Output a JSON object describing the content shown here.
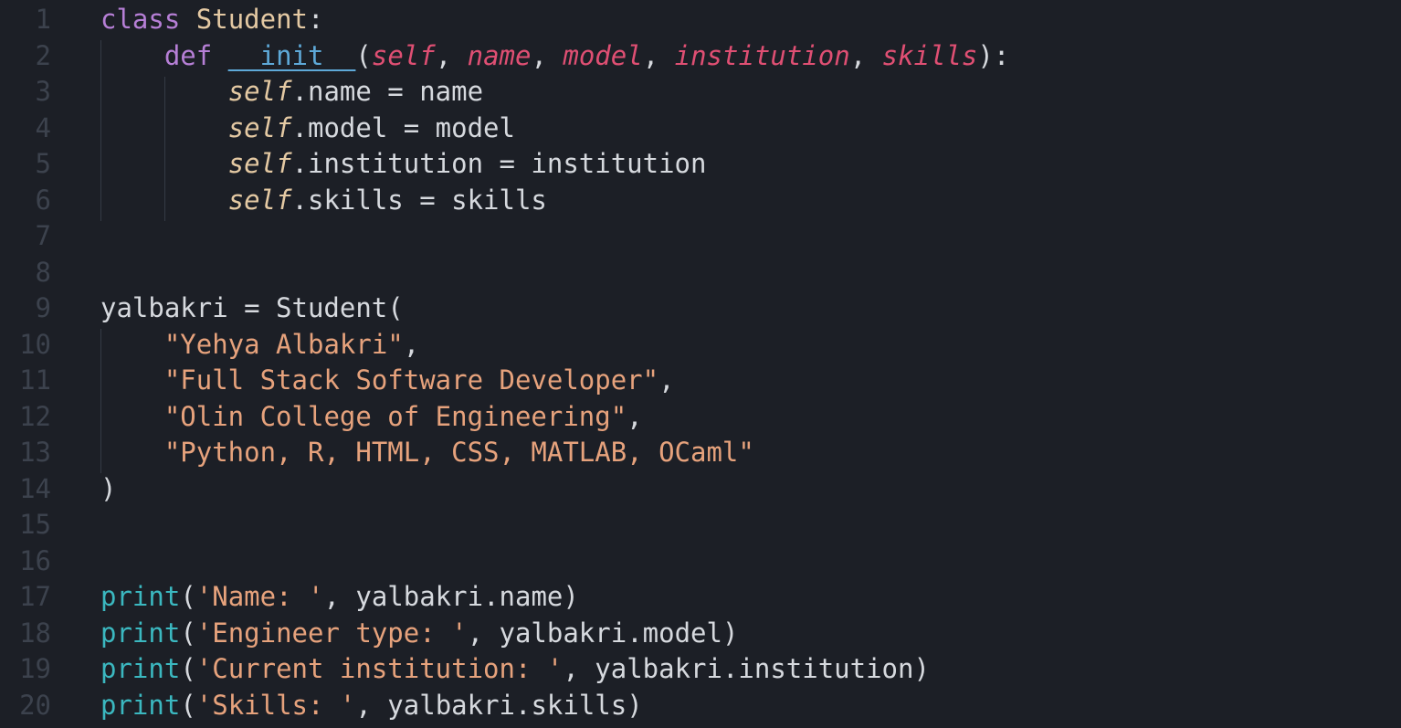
{
  "editor": {
    "lines": [
      {
        "n": "1",
        "tokens": [
          [
            "kw",
            "class"
          ],
          [
            "plain",
            " "
          ],
          [
            "cls",
            "Student"
          ],
          [
            "plain",
            ":"
          ]
        ]
      },
      {
        "n": "2",
        "tokens": [
          [
            "plain",
            "    "
          ],
          [
            "kw",
            "def"
          ],
          [
            "plain",
            " "
          ],
          [
            "fn-def",
            "__init__"
          ],
          [
            "plain",
            "("
          ],
          [
            "param",
            "self"
          ],
          [
            "plain",
            ", "
          ],
          [
            "param",
            "name"
          ],
          [
            "plain",
            ", "
          ],
          [
            "param",
            "model"
          ],
          [
            "plain",
            ", "
          ],
          [
            "param",
            "institution"
          ],
          [
            "plain",
            ", "
          ],
          [
            "param",
            "skills"
          ],
          [
            "plain",
            "):"
          ]
        ]
      },
      {
        "n": "3",
        "tokens": [
          [
            "plain",
            "        "
          ],
          [
            "self",
            "self"
          ],
          [
            "plain",
            ".name = name"
          ]
        ]
      },
      {
        "n": "4",
        "tokens": [
          [
            "plain",
            "        "
          ],
          [
            "self",
            "self"
          ],
          [
            "plain",
            ".model = model"
          ]
        ]
      },
      {
        "n": "5",
        "tokens": [
          [
            "plain",
            "        "
          ],
          [
            "self",
            "self"
          ],
          [
            "plain",
            ".institution = institution"
          ]
        ]
      },
      {
        "n": "6",
        "tokens": [
          [
            "plain",
            "        "
          ],
          [
            "self",
            "self"
          ],
          [
            "plain",
            ".skills = skills"
          ]
        ]
      },
      {
        "n": "7",
        "tokens": []
      },
      {
        "n": "8",
        "tokens": []
      },
      {
        "n": "9",
        "tokens": [
          [
            "plain",
            "yalbakri = Student("
          ]
        ]
      },
      {
        "n": "10",
        "tokens": [
          [
            "plain",
            "    "
          ],
          [
            "str",
            "\"Yehya Albakri\""
          ],
          [
            "plain",
            ","
          ]
        ]
      },
      {
        "n": "11",
        "tokens": [
          [
            "plain",
            "    "
          ],
          [
            "str",
            "\"Full Stack Software Developer\""
          ],
          [
            "plain",
            ","
          ]
        ]
      },
      {
        "n": "12",
        "tokens": [
          [
            "plain",
            "    "
          ],
          [
            "str",
            "\"Olin College of Engineering\""
          ],
          [
            "plain",
            ","
          ]
        ]
      },
      {
        "n": "13",
        "tokens": [
          [
            "plain",
            "    "
          ],
          [
            "str",
            "\"Python, R, HTML, CSS, MATLAB, OCaml\""
          ]
        ]
      },
      {
        "n": "14",
        "tokens": [
          [
            "plain",
            ")"
          ]
        ]
      },
      {
        "n": "15",
        "tokens": []
      },
      {
        "n": "16",
        "tokens": []
      },
      {
        "n": "17",
        "tokens": [
          [
            "builtin",
            "print"
          ],
          [
            "plain",
            "("
          ],
          [
            "str",
            "'Name: '"
          ],
          [
            "plain",
            ", yalbakri.name)"
          ]
        ]
      },
      {
        "n": "18",
        "tokens": [
          [
            "builtin",
            "print"
          ],
          [
            "plain",
            "("
          ],
          [
            "str",
            "'Engineer type: '"
          ],
          [
            "plain",
            ", yalbakri.model)"
          ]
        ]
      },
      {
        "n": "19",
        "tokens": [
          [
            "builtin",
            "print"
          ],
          [
            "plain",
            "("
          ],
          [
            "str",
            "'Current institution: '"
          ],
          [
            "plain",
            ", yalbakri.institution)"
          ]
        ]
      },
      {
        "n": "20",
        "tokens": [
          [
            "builtin",
            "print"
          ],
          [
            "plain",
            "("
          ],
          [
            "str",
            "'Skills: '"
          ],
          [
            "plain",
            ", yalbakri.skills)"
          ]
        ]
      }
    ]
  },
  "colors": {
    "background": "#1c1f26",
    "line_number": "#3c424d",
    "keyword": "#b67fd6",
    "class_name": "#e4c9a3",
    "function_def": "#5ea9d8",
    "parameter": "#df4f73",
    "string": "#e6a27c",
    "builtin": "#3bb8c0",
    "text": "#d6d9de"
  }
}
